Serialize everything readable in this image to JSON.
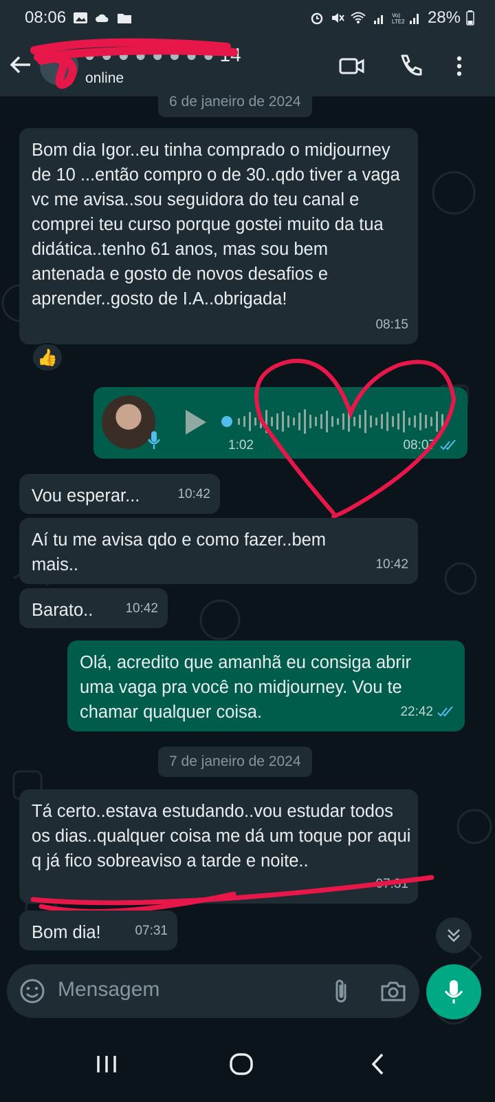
{
  "status_bar": {
    "time": "08:06",
    "battery": "28%"
  },
  "header": {
    "name_suffix": "14",
    "status": "online"
  },
  "chat": {
    "date_1": "6 de janeiro de 2024",
    "date_2": "7 de janeiro de 2024",
    "messages": [
      {
        "text": "Bom dia Igor..eu tinha comprado o midjourney de 10 ...então compro o de 30..qdo tiver a vaga vc me avisa..sou seguidora do teu canal e comprei teu curso porque gostei muito da tua didática..tenho 61 anos, mas sou bem antenada e gosto de novos desafios e aprender..gosto de I.A..obrigada!",
        "time": "08:15"
      },
      {
        "text": "Vou esperar...",
        "time": "10:42"
      },
      {
        "text": "Aí tu me avisa qdo e como fazer..bem mais..",
        "time": "10:42"
      },
      {
        "text": "Barato..",
        "time": "10:42"
      },
      {
        "text": "Olá, acredito que amanhã eu consiga abrir uma vaga pra você no midjourney. Vou te chamar qualquer coisa.",
        "time": "22:42"
      },
      {
        "text": "Tá certo..estava estudando..vou estudar todos os dias..qualquer coisa me dá um toque por aqui q já fico sobreaviso a tarde e noite..",
        "time": "07:31"
      },
      {
        "text": "Bom dia!",
        "time": "07:31"
      }
    ],
    "voice": {
      "duration": "1:02",
      "time": "08:07"
    },
    "reaction": "👍"
  },
  "input": {
    "placeholder": "Mensagem"
  },
  "colors": {
    "incoming": "#1f2c34",
    "outgoing": "#005c4b",
    "accent": "#00a884",
    "scribble": "#e8174a"
  },
  "icons": [
    "back-arrow-icon",
    "video-call-icon",
    "phone-icon",
    "more-icon",
    "emoji-icon",
    "attach-icon",
    "camera-icon",
    "mic-icon",
    "play-icon",
    "double-check-icon"
  ]
}
